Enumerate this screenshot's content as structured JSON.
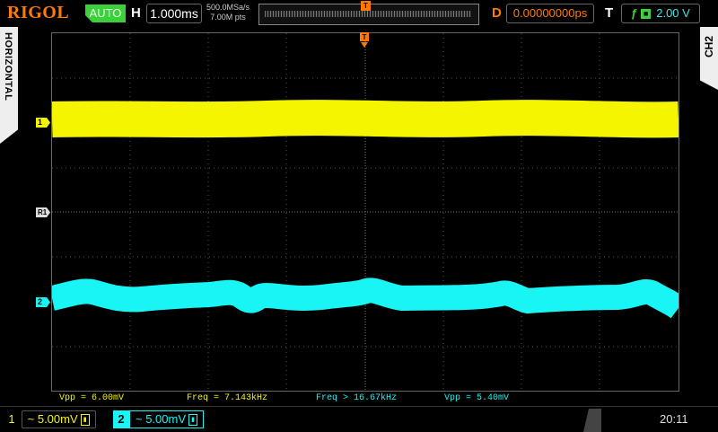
{
  "header": {
    "brand": "RIGOL",
    "run_state": "AUTO",
    "horizontal_label": "H",
    "timebase": "1.000ms",
    "sample_rate": "500.0MSa/s",
    "memory_depth": "7.00M pts",
    "trigger_pos_marker": "T",
    "delay_label": "D",
    "delay_value": "0.00000000ps",
    "trigger_label": "T",
    "trigger_level": "2.00 V",
    "trigger_source_icon": "square-source-icon",
    "trigger_edge_icon": "rising-edge-icon"
  },
  "side": {
    "left_tab": "HORIZONTAL",
    "right_tab": "CH2"
  },
  "markers": {
    "ch1": "1",
    "ch2": "2",
    "ref": "R1"
  },
  "measurements": [
    "Vpp = 6.00mV",
    "Freq = 7.143kHz",
    "Freq > 16.67kHz",
    "Vpp = 5.40mV"
  ],
  "channels": {
    "ch1": {
      "number": "1",
      "coupling_symbol": "~",
      "scale": "5.00mV",
      "color": "#f5f500"
    },
    "ch2": {
      "number": "2",
      "coupling_symbol": "~",
      "scale": "5.00mV",
      "color": "#19f5f5"
    }
  },
  "status": {
    "clock": "20:11"
  },
  "colors": {
    "accent": "#ff7a00",
    "run_state": "#3bd13b",
    "grid": "#666666"
  }
}
